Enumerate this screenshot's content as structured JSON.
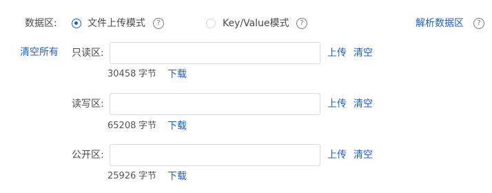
{
  "header": {
    "data_area_label": "数据区:",
    "mode_file_label": "文件上传模式",
    "mode_kv_label": "Key/Value模式",
    "parse_label": "解析数据区",
    "help_glyph": "?"
  },
  "clear_all_label": "清空所有",
  "areas": [
    {
      "label": "只读区:",
      "value": "",
      "upload_label": "上传",
      "clear_label": "清空",
      "bytes": "30458",
      "bytes_unit": "字节",
      "download_label": "下载"
    },
    {
      "label": "读写区:",
      "value": "",
      "upload_label": "上传",
      "clear_label": "清空",
      "bytes": "65208",
      "bytes_unit": "字节",
      "download_label": "下载"
    },
    {
      "label": "公开区:",
      "value": "",
      "upload_label": "上传",
      "clear_label": "清空",
      "bytes": "25926",
      "bytes_unit": "字节",
      "download_label": "下载"
    }
  ],
  "colors": {
    "link": "#1f5fbf",
    "text": "#4a4a4a",
    "disabled": "#bdbdbd",
    "border": "#d9d9d9"
  },
  "icons": {
    "radio_selected": "radio-selected-icon",
    "radio_unselected": "radio-unselected-icon",
    "help": "question-circle-icon"
  }
}
